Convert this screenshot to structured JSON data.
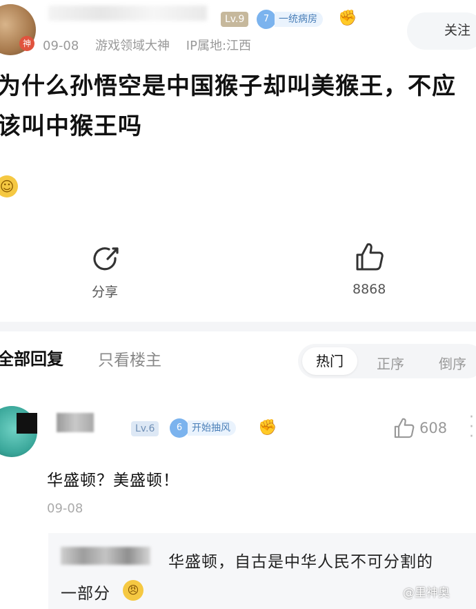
{
  "post": {
    "author_badge": "神",
    "level": "Lv.9",
    "badge_level": "7",
    "badge_title": "一统病房",
    "follow_label": "关注",
    "date": "09-08",
    "tag": "游戏领域大神",
    "ip": "IP属地:江西",
    "title": "为什么孙悟空是中国猴子却叫美猴王，不应该叫中猴王吗",
    "emoji": "grin-emoji"
  },
  "actions": {
    "share_label": "分享",
    "share_icon": "share-icon",
    "like_icon": "thumbs-up-icon",
    "like_count": "8868"
  },
  "reply_tabs": {
    "all": "全部回复",
    "owner_only": "只看楼主",
    "sort_options": [
      "热门",
      "正序",
      "倒序"
    ],
    "selected_sort": "热门"
  },
  "comment": {
    "level": "Lv.6",
    "badge_level": "6",
    "badge_title": "开始抽风",
    "like_count": "608",
    "text": "华盛顿？美盛顿！",
    "date": "09-08",
    "reply": {
      "text_line1": "华盛顿，自古是中华人民不可分割的",
      "text_line2": "一部分",
      "emoji": "angry-emoji"
    }
  },
  "watermark": "@里神奥"
}
